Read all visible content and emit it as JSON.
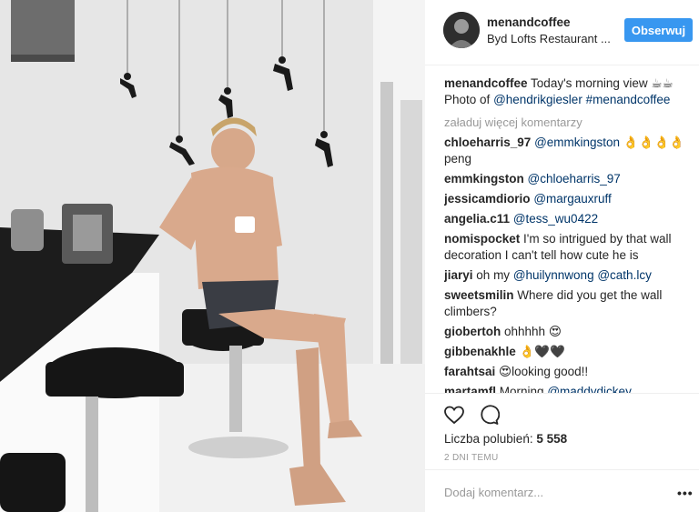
{
  "header": {
    "username": "menandcoffee",
    "location": "Byd Lofts Restaurant ...",
    "follow_label": "Obserwuj"
  },
  "caption": {
    "username": "menandcoffee",
    "text": "Today's morning view ☕☕",
    "line2_prefix": "Photo of",
    "mention": "@hendrikgiesler",
    "hashtag": "#menandcoffee"
  },
  "load_more": "załaduj więcej komentarzy",
  "comments": [
    {
      "user": "chloeharris_97",
      "mention": "@emmkingston",
      "text": " 👌👌👌👌 peng"
    },
    {
      "user": "emmkingston",
      "mention": "@chloeharris_97",
      "text": ""
    },
    {
      "user": "jessicamdiorio",
      "mention": "@margauxruff",
      "text": ""
    },
    {
      "user": "angelia.c11",
      "mention": "@tess_wu0422",
      "text": ""
    },
    {
      "user": "nomispocket",
      "mention": "",
      "text": "I'm so intrigued by that wall decoration I can't tell how cute he is"
    },
    {
      "user": "jiaryi",
      "mention": "",
      "text": "oh my ",
      "mention2": "@huilynnwong",
      "mention3": "@cath.lcy"
    },
    {
      "user": "sweetsmilin",
      "mention": "",
      "text": "Where did you get the wall climbers?"
    },
    {
      "user": "giobertoh",
      "mention": "",
      "text": "ohhhhh 😍"
    },
    {
      "user": "gibbenakhle",
      "mention": "",
      "text": "👌🖤🖤"
    },
    {
      "user": "farahtsai",
      "mention": "",
      "text": "😍looking good!!"
    },
    {
      "user": "martamfl",
      "mention": "",
      "text": "Morning ",
      "mention2": "@maddydickey"
    }
  ],
  "likes": {
    "label": "Liczba polubień:",
    "count": "5 558"
  },
  "date": "2 DNI TEMU",
  "add_comment_placeholder": "Dodaj komentarz...",
  "more_options": "•••",
  "icons": {
    "like": "heart-icon",
    "comment": "comment-bubble-icon",
    "more": "more-options-icon"
  },
  "colors": {
    "follow_button": "#3897f0",
    "link": "#003569",
    "muted": "#999999",
    "text": "#262626"
  }
}
